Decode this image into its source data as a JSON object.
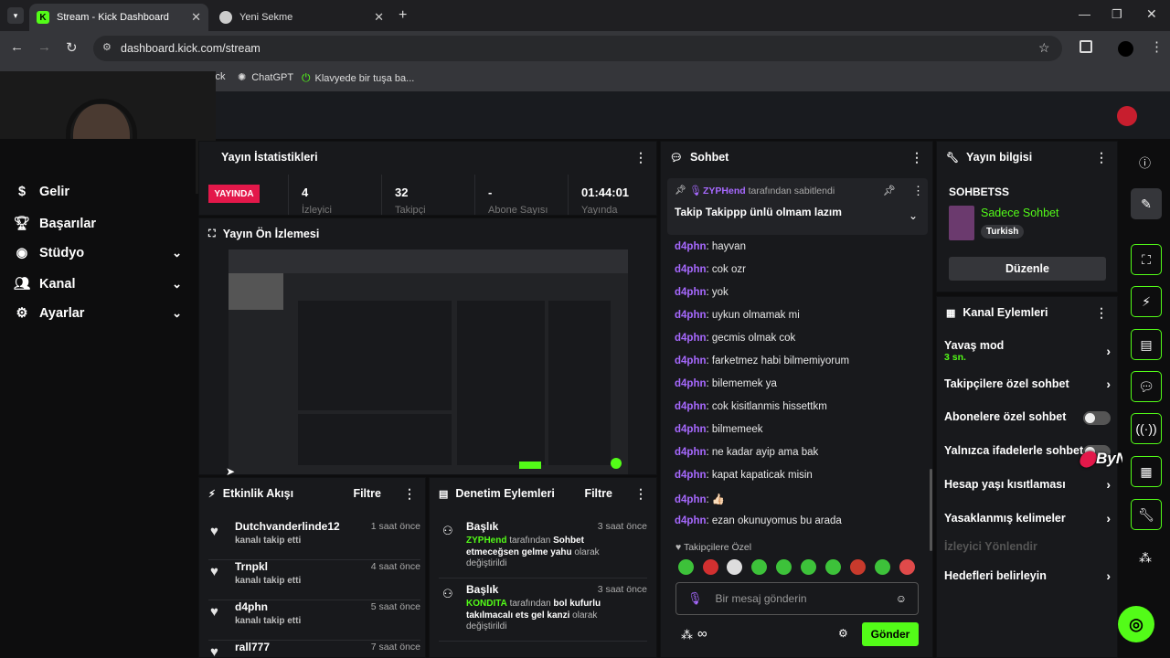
{
  "browser": {
    "tabs": [
      {
        "title": "Stream - Kick Dashboard",
        "active": true
      },
      {
        "title": "Yeni Sekme",
        "active": false
      }
    ],
    "url": "dashboard.kick.com/stream",
    "bookmarks": [
      "ick",
      "ChatGPT",
      "Klavyede bir tuşa ba..."
    ]
  },
  "sidebar": {
    "items": [
      {
        "label": "Gelir",
        "icon": "dollar-icon",
        "expandable": false
      },
      {
        "label": "Başarılar",
        "icon": "trophy-icon",
        "expandable": false
      },
      {
        "label": "Stüdyo",
        "icon": "studio-icon",
        "expandable": true
      },
      {
        "label": "Kanal",
        "icon": "users-icon",
        "expandable": true
      },
      {
        "label": "Ayarlar",
        "icon": "gear-icon",
        "expandable": true
      }
    ]
  },
  "stats": {
    "title": "Yayın İstatistikleri",
    "live_badge": "YAYINDA",
    "items": [
      {
        "value": "4",
        "label": "İzleyici"
      },
      {
        "value": "32",
        "label": "Takipçi"
      },
      {
        "value": "-",
        "label": "Abone Sayısı"
      },
      {
        "value": "01:44:01",
        "label": "Yayında"
      }
    ]
  },
  "preview": {
    "title": "Yayın Ön İzlemesi"
  },
  "events": {
    "title": "Etkinlik Akışı",
    "filter": "Filtre",
    "items": [
      {
        "name": "Dutchvanderlinde12",
        "action": "kanalı takip etti",
        "time": "1 saat önce"
      },
      {
        "name": "Trnpkl",
        "action": "kanalı takip etti",
        "time": "4 saat önce"
      },
      {
        "name": "d4phn",
        "action": "kanalı takip etti",
        "time": "5 saat önce"
      },
      {
        "name": "rall777",
        "action": "",
        "time": "7 saat önce"
      }
    ]
  },
  "moderation": {
    "title": "Denetim Eylemleri",
    "filter": "Filtre",
    "items": [
      {
        "title": "Başlık",
        "time": "3 saat önce",
        "user": "ZYPHend",
        "mid": "tarafından",
        "value": "Sohbet etmeceğsen gelme yahu",
        "suffix": "olarak değiştirildi"
      },
      {
        "title": "Başlık",
        "time": "3 saat önce",
        "user": "KONDITA",
        "mid": "tarafından",
        "value": "bol kufurlu takılmacalı ets gel kanzi",
        "suffix": "olarak değiştirildi"
      }
    ]
  },
  "chat": {
    "title": "Sohbet",
    "pinned_by_user": "ZYPHend",
    "pinned_by_text": "tarafından sabitlendi",
    "pinned_message": "Takip Takippp ünlü olmam lazım",
    "messages": [
      {
        "user": "d4phn",
        "text": "hayvan"
      },
      {
        "user": "d4phn",
        "text": "cok ozr"
      },
      {
        "user": "d4phn",
        "text": "yok"
      },
      {
        "user": "d4phn",
        "text": "uykun olmamak mi"
      },
      {
        "user": "d4phn",
        "text": "gecmis olmak cok"
      },
      {
        "user": "d4phn",
        "text": "farketmez habi bilmemiyorum"
      },
      {
        "user": "d4phn",
        "text": "bilememek ya"
      },
      {
        "user": "d4phn",
        "text": "cok kisitlanmis hissettkm"
      },
      {
        "user": "d4phn",
        "text": "bilmemeek"
      },
      {
        "user": "d4phn",
        "text": "ne kadar ayip ama bak"
      },
      {
        "user": "d4phn",
        "text": "kapat kapaticak misin"
      },
      {
        "user": "d4phn",
        "text": "👍🏻"
      },
      {
        "user": "d4phn",
        "text": "ezan okunuyomus bu arada"
      }
    ],
    "followers_only_label": "Takipçilere Özel",
    "input_placeholder": "Bir mesaj gönderin",
    "send_label": "Gönder"
  },
  "stream_info": {
    "title": "Yayın bilgisi",
    "stream_title": "SOHBETSS",
    "category": "Sadece Sohbet",
    "language": "Turkish",
    "edit_label": "Düzenle"
  },
  "channel_actions": {
    "title": "Kanal Eylemleri",
    "slow_mode": "Yavaş mod",
    "slow_mode_value": "3 sn.",
    "followers_only": "Takipçilere özel sohbet",
    "subscribers_only": "Abonelere özel sohbet",
    "emotes_only": "Yalnızca ifadelerle sohbet",
    "account_age": "Hesap yaşı kısıtlaması",
    "banned_words": "Yasaklanmış kelimeler",
    "viewer_direction": "İzleyici Yönlendir",
    "set_goals": "Hedefleri belirleyin"
  },
  "watermark": "ByNoGame",
  "colors": {
    "accent": "#53fc18",
    "username": "#a769ff",
    "live": "#e3184a"
  }
}
